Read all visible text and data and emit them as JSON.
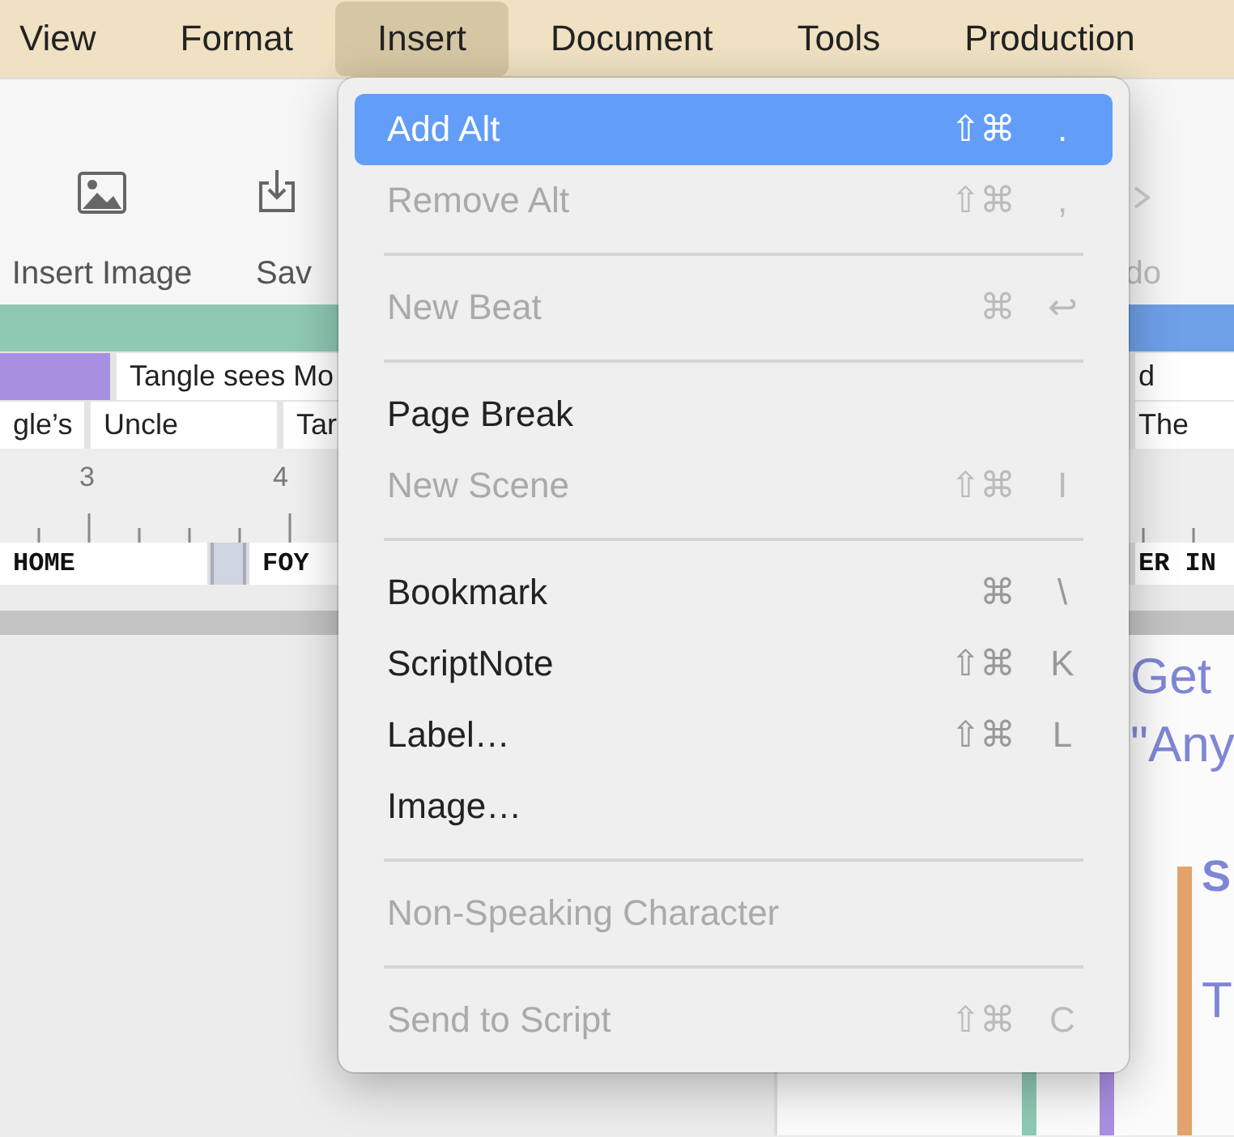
{
  "menubar": {
    "items": [
      {
        "label": "View",
        "selected": false
      },
      {
        "label": "Format",
        "selected": false
      },
      {
        "label": "Insert",
        "selected": true
      },
      {
        "label": "Document",
        "selected": false
      },
      {
        "label": "Tools",
        "selected": false
      },
      {
        "label": "Production",
        "selected": false
      }
    ]
  },
  "toolbar": {
    "items": [
      {
        "kind": "image",
        "label": "Insert Image"
      },
      {
        "kind": "save",
        "label": "Sav"
      }
    ],
    "trailing": {
      "kind": "redo",
      "label": "do"
    }
  },
  "timeline": {
    "rows": [
      {
        "cards": [
          {
            "kind": "block",
            "color": "#a98fe0"
          },
          {
            "kind": "text",
            "label": "Tangle sees Mo"
          }
        ],
        "trailing": "d"
      },
      {
        "cards": [
          {
            "kind": "text",
            "label": "gle’s"
          },
          {
            "kind": "text",
            "label": "Uncle"
          },
          {
            "kind": "text",
            "label": "Tar"
          }
        ],
        "trailing": "The"
      }
    ],
    "ruler": [
      "3",
      "4"
    ],
    "scenes": [
      {
        "kind": "text",
        "label": "HOME"
      },
      {
        "kind": "divider"
      },
      {
        "kind": "text",
        "label": "FOY"
      }
    ],
    "scenes_trailing": "ER IN"
  },
  "script": {
    "lines": [
      {
        "kind": "plain",
        "text": "Get"
      },
      {
        "kind": "plain",
        "text": "\"Any"
      },
      {
        "kind": "heading",
        "text": "S"
      },
      {
        "kind": "plain",
        "text": "T"
      }
    ]
  },
  "menu": {
    "items": [
      {
        "kind": "item",
        "label": "Add Alt",
        "modifiers": "⇧⌘",
        "key": ".",
        "disabled": false,
        "selected": true
      },
      {
        "kind": "item",
        "label": "Remove Alt",
        "modifiers": "⇧⌘",
        "key": ",",
        "disabled": true,
        "selected": false
      },
      {
        "kind": "separator"
      },
      {
        "kind": "item",
        "label": "New Beat",
        "modifiers": "⌘",
        "key": "↩",
        "disabled": true,
        "selected": false
      },
      {
        "kind": "separator"
      },
      {
        "kind": "item",
        "label": "Page Break",
        "disabled": false,
        "selected": false
      },
      {
        "kind": "item",
        "label": "New Scene",
        "modifiers": "⇧⌘",
        "key": "I",
        "disabled": true,
        "selected": false
      },
      {
        "kind": "separator"
      },
      {
        "kind": "item",
        "label": "Bookmark",
        "modifiers": "⌘",
        "key": "\\",
        "disabled": false,
        "selected": false
      },
      {
        "kind": "item",
        "label": "ScriptNote",
        "modifiers": "⇧⌘",
        "key": "K",
        "disabled": false,
        "selected": false
      },
      {
        "kind": "item",
        "label": "Label…",
        "modifiers": "⇧⌘",
        "key": "L",
        "disabled": false,
        "selected": false
      },
      {
        "kind": "item",
        "label": "Image…",
        "disabled": false,
        "selected": false
      },
      {
        "kind": "separator"
      },
      {
        "kind": "item",
        "label": "Non-Speaking Character",
        "disabled": true,
        "selected": false
      },
      {
        "kind": "separator"
      },
      {
        "kind": "item",
        "label": "Send to Script",
        "modifiers": "⇧⌘",
        "key": "C",
        "disabled": true,
        "selected": false
      }
    ]
  }
}
